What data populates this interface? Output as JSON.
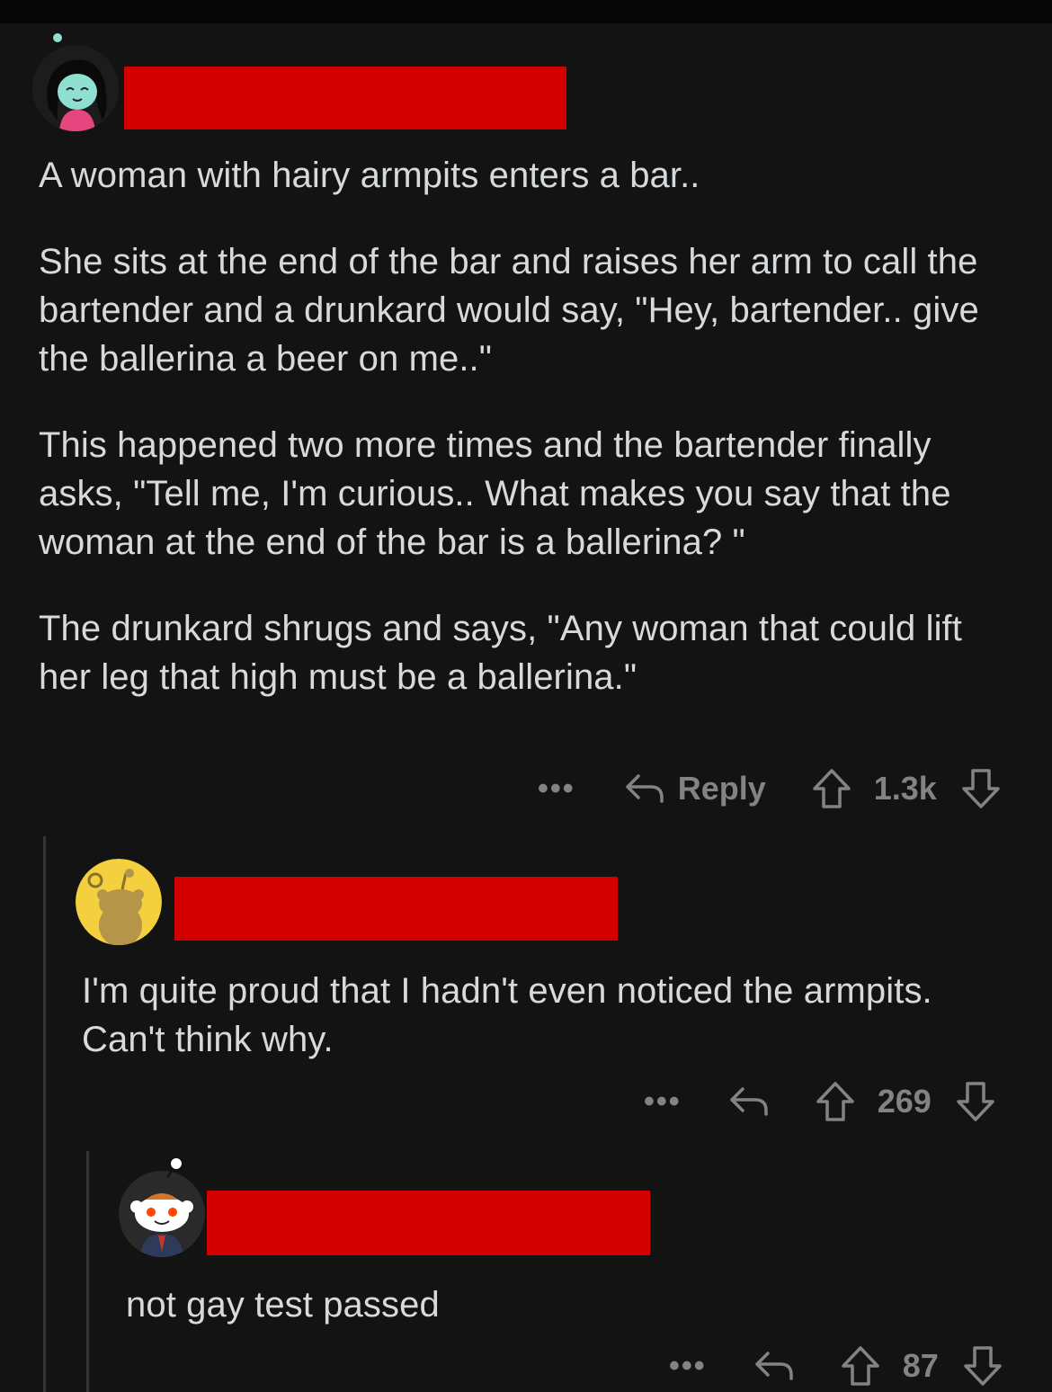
{
  "comments": [
    {
      "avatar": "woman-avatar-icon",
      "redaction_color": "#d40000",
      "paragraphs": [
        "A woman with hairy armpits enters a bar..",
        "She sits at the end of the bar and raises her arm to call the bartender and a drunkard would say, \"Hey, bartender.. give the ballerina a beer on me..\"",
        "This happened two more times and the bartender finally asks, \"Tell me, I'm curious.. What makes you say that the woman at the end of the bar is a ballerina? \"",
        "The drunkard shrugs and says, \"Any woman that could lift her leg that high must be a ballerina.\""
      ],
      "actions": {
        "more": "•••",
        "reply_label": "Reply",
        "score": "1.3k"
      }
    },
    {
      "avatar": "snoo-yellow-avatar-icon",
      "redaction_color": "#d40000",
      "paragraphs": [
        "I'm quite proud that I hadn't even noticed the armpits. Can't think why."
      ],
      "actions": {
        "more": "•••",
        "score": "269"
      }
    },
    {
      "avatar": "snoo-suit-avatar-icon",
      "redaction_color": "#d40000",
      "paragraphs": [
        "not gay test passed"
      ],
      "actions": {
        "more": "•••",
        "score": "87"
      }
    }
  ],
  "colors": {
    "background": "#131313",
    "text": "#d7dadc",
    "muted": "#818384",
    "redaction": "#d40000"
  }
}
